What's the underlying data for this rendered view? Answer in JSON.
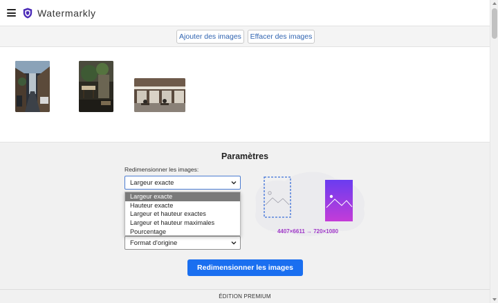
{
  "app": {
    "title": "Watermarkly",
    "brand_color": "#4b2bb8"
  },
  "toolbar": {
    "add_label": "Ajouter des images",
    "clear_label": "Effacer des images"
  },
  "settings": {
    "title": "Paramètres",
    "resize_label": "Redimensionner les images:",
    "resize_mode_value": "Largeur exacte",
    "resize_options": [
      "Largeur exacte",
      "Hauteur exacte",
      "Largeur et hauteur exactes",
      "Largeur et hauteur maximales",
      "Pourcentage"
    ],
    "format_value": "Format d'origine",
    "dimensions_text": "4407×6611 → 720×1080",
    "submit_label": "Redimensionner les images"
  },
  "footer": {
    "text": "ÉDITION PREMIUM"
  },
  "colors": {
    "accent": "#1a6ff0",
    "link": "#2f63b0",
    "gradient_start": "#6a3cf0",
    "gradient_end": "#c43cd8"
  },
  "icons": [
    "menu-icon",
    "shield-logo-icon",
    "chevron-down-icon",
    "image-placeholder-icon"
  ]
}
